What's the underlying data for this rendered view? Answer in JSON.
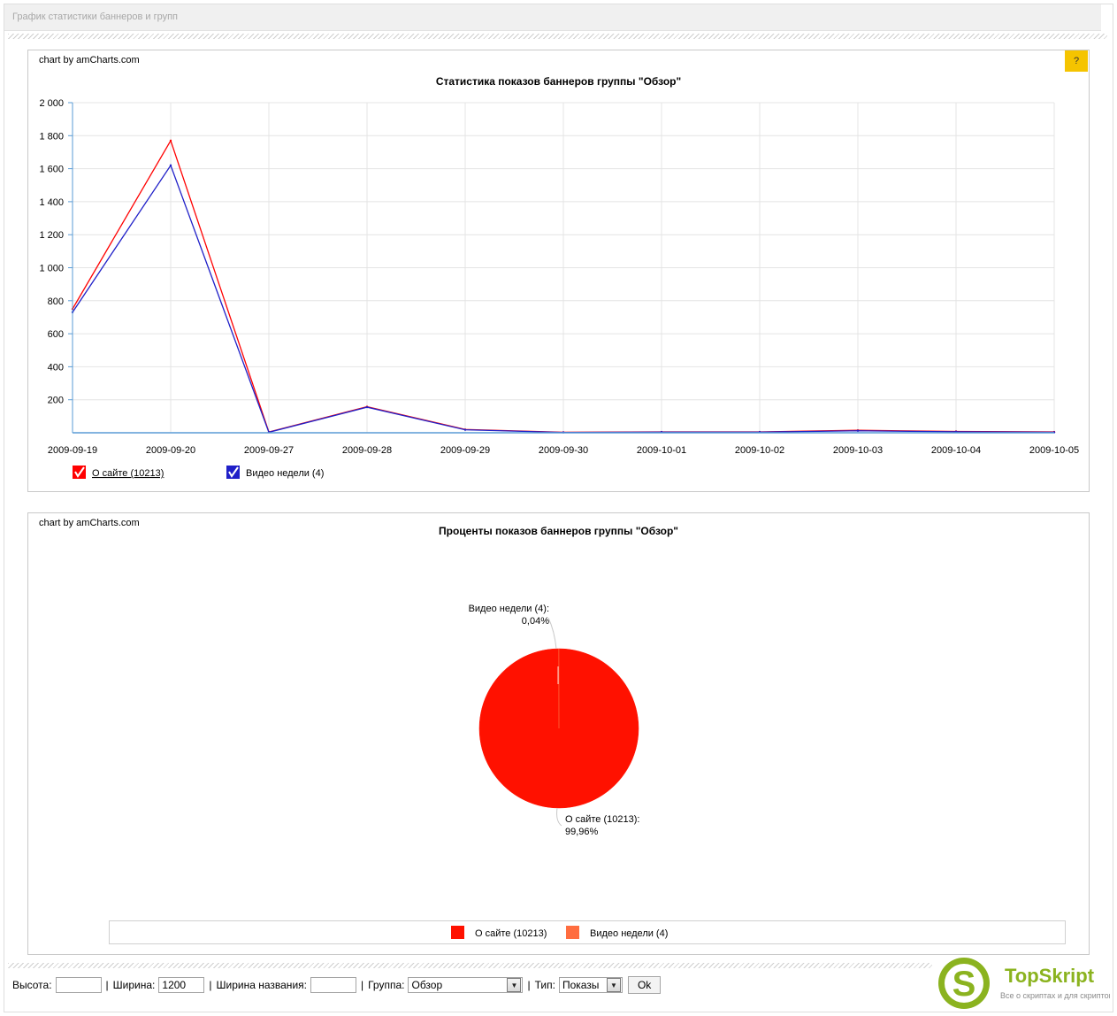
{
  "header": {
    "title": "График статистики баннеров и групп"
  },
  "line_panel": {
    "credit": "chart by amCharts.com",
    "help_label": "?"
  },
  "pie_panel": {
    "credit": "chart by amCharts.com"
  },
  "chart_data": [
    {
      "type": "line",
      "title": "Статистика показов баннеров группы \"Обзор\"",
      "categories": [
        "2009-09-19",
        "2009-09-20",
        "2009-09-27",
        "2009-09-28",
        "2009-09-29",
        "2009-09-30",
        "2009-10-01",
        "2009-10-02",
        "2009-10-03",
        "2009-10-04",
        "2009-10-05"
      ],
      "y_ticks": [
        {
          "value": 200,
          "label": "200"
        },
        {
          "value": 400,
          "label": "400"
        },
        {
          "value": 600,
          "label": "600"
        },
        {
          "value": 800,
          "label": "800"
        },
        {
          "value": 1000,
          "label": "1 000"
        },
        {
          "value": 1200,
          "label": "1 200"
        },
        {
          "value": 1400,
          "label": "1 400"
        },
        {
          "value": 1600,
          "label": "1 600"
        },
        {
          "value": 1800,
          "label": "1 800"
        },
        {
          "value": 2000,
          "label": "2 000"
        }
      ],
      "ylim": [
        0,
        2000
      ],
      "grid": true,
      "legend_position": "bottom-left",
      "series": [
        {
          "name": "О сайте (10213)",
          "color": "#ff0000",
          "values": [
            750,
            1770,
            5,
            158,
            20,
            3,
            5,
            5,
            15,
            8,
            5
          ]
        },
        {
          "name": "Видео недели (4)",
          "color": "#2020c8",
          "values": [
            730,
            1620,
            3,
            155,
            18,
            2,
            4,
            4,
            12,
            6,
            3
          ]
        }
      ]
    },
    {
      "type": "pie",
      "title": "Проценты показов баннеров группы \"Обзор\"",
      "slices": [
        {
          "name": "О сайте (10213)",
          "value": 10213,
          "percent_label": "99,96%",
          "color": "#ff1100"
        },
        {
          "name": "Видео недели (4)",
          "value": 4,
          "percent_label": "0,04%",
          "color": "#ff6d3f"
        }
      ],
      "legend_position": "bottom"
    }
  ],
  "controls": {
    "height_label": "Высота:",
    "height_value": "",
    "width_label": "Ширина:",
    "width_value": "1200",
    "title_width_label": "Ширина названия:",
    "title_width_value": "",
    "group_label": "Группа:",
    "group_value": "Обзор",
    "type_label": "Тип:",
    "type_value": "Показы",
    "ok_label": "Ok"
  },
  "logo": {
    "name": "TopSkript",
    "tagline": "Все о скриптах и для скриптов...",
    "mark": "S"
  }
}
